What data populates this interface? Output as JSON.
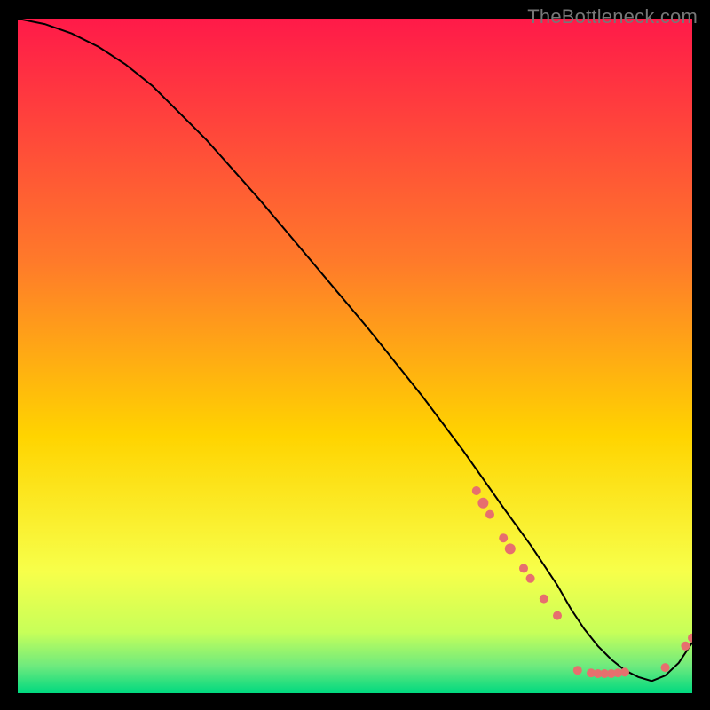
{
  "watermark": "TheBottleneck.com",
  "chart_data": {
    "type": "line",
    "title": "",
    "xlabel": "",
    "ylabel": "",
    "xlim": [
      0,
      100
    ],
    "ylim": [
      0,
      100
    ],
    "grid": false,
    "legend": false,
    "background_gradient_top": "#ff1a49",
    "background_gradient_mid": "#ffd400",
    "background_gradient_bottom": "#00d97f",
    "series": [
      {
        "name": "bottleneck-curve",
        "x": [
          0,
          4,
          8,
          12,
          16,
          20,
          28,
          36,
          44,
          52,
          60,
          66,
          72,
          76,
          80,
          82,
          84,
          86,
          88,
          90,
          92,
          94,
          96,
          98,
          100
        ],
        "y": [
          100,
          99.2,
          97.8,
          95.8,
          93.2,
          90.0,
          82.0,
          73.0,
          63.5,
          54.0,
          44.0,
          36.0,
          27.5,
          22.0,
          16.0,
          12.5,
          9.5,
          7.0,
          5.0,
          3.4,
          2.4,
          1.8,
          2.6,
          4.5,
          7.5
        ]
      }
    ],
    "markers": [
      {
        "x": 68,
        "y": 30.0,
        "r": 5
      },
      {
        "x": 69,
        "y": 28.2,
        "r": 6
      },
      {
        "x": 70,
        "y": 26.5,
        "r": 5
      },
      {
        "x": 72,
        "y": 23.0,
        "r": 5
      },
      {
        "x": 73,
        "y": 21.4,
        "r": 6
      },
      {
        "x": 75,
        "y": 18.5,
        "r": 5
      },
      {
        "x": 76,
        "y": 17.0,
        "r": 5
      },
      {
        "x": 78,
        "y": 14.0,
        "r": 5
      },
      {
        "x": 80,
        "y": 11.5,
        "r": 5
      },
      {
        "x": 83,
        "y": 3.4,
        "r": 5
      },
      {
        "x": 85,
        "y": 3.0,
        "r": 5
      },
      {
        "x": 86,
        "y": 2.9,
        "r": 5
      },
      {
        "x": 87,
        "y": 2.9,
        "r": 5
      },
      {
        "x": 88,
        "y": 2.9,
        "r": 5
      },
      {
        "x": 89,
        "y": 3.0,
        "r": 5
      },
      {
        "x": 90,
        "y": 3.1,
        "r": 5
      },
      {
        "x": 96,
        "y": 3.8,
        "r": 5
      },
      {
        "x": 99,
        "y": 7.0,
        "r": 5
      },
      {
        "x": 100,
        "y": 8.2,
        "r": 5
      }
    ],
    "marker_color": "#e76f6e"
  }
}
